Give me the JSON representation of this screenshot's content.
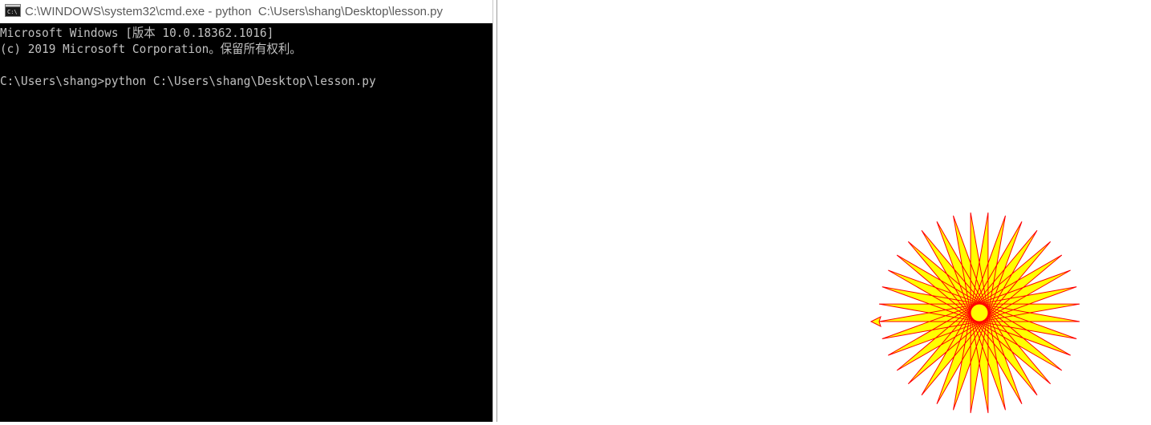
{
  "cmd": {
    "title": "C:\\WINDOWS\\system32\\cmd.exe - python  C:\\Users\\shang\\Desktop\\lesson.py",
    "icon": "cmd-icon",
    "lines": [
      "Microsoft Windows [版本 10.0.18362.1016]",
      "(c) 2019 Microsoft Corporation。保留所有权利。",
      "",
      "C:\\Users\\shang>python C:\\Users\\shang\\Desktop\\lesson.py"
    ],
    "background_color": "#000000",
    "text_color": "#c0c0c0"
  },
  "turtle": {
    "drawing": "star-burst",
    "pen_color": "#ff0000",
    "fill_color": "#ffff00",
    "cursor_icon": "turtle-arrow-icon"
  }
}
